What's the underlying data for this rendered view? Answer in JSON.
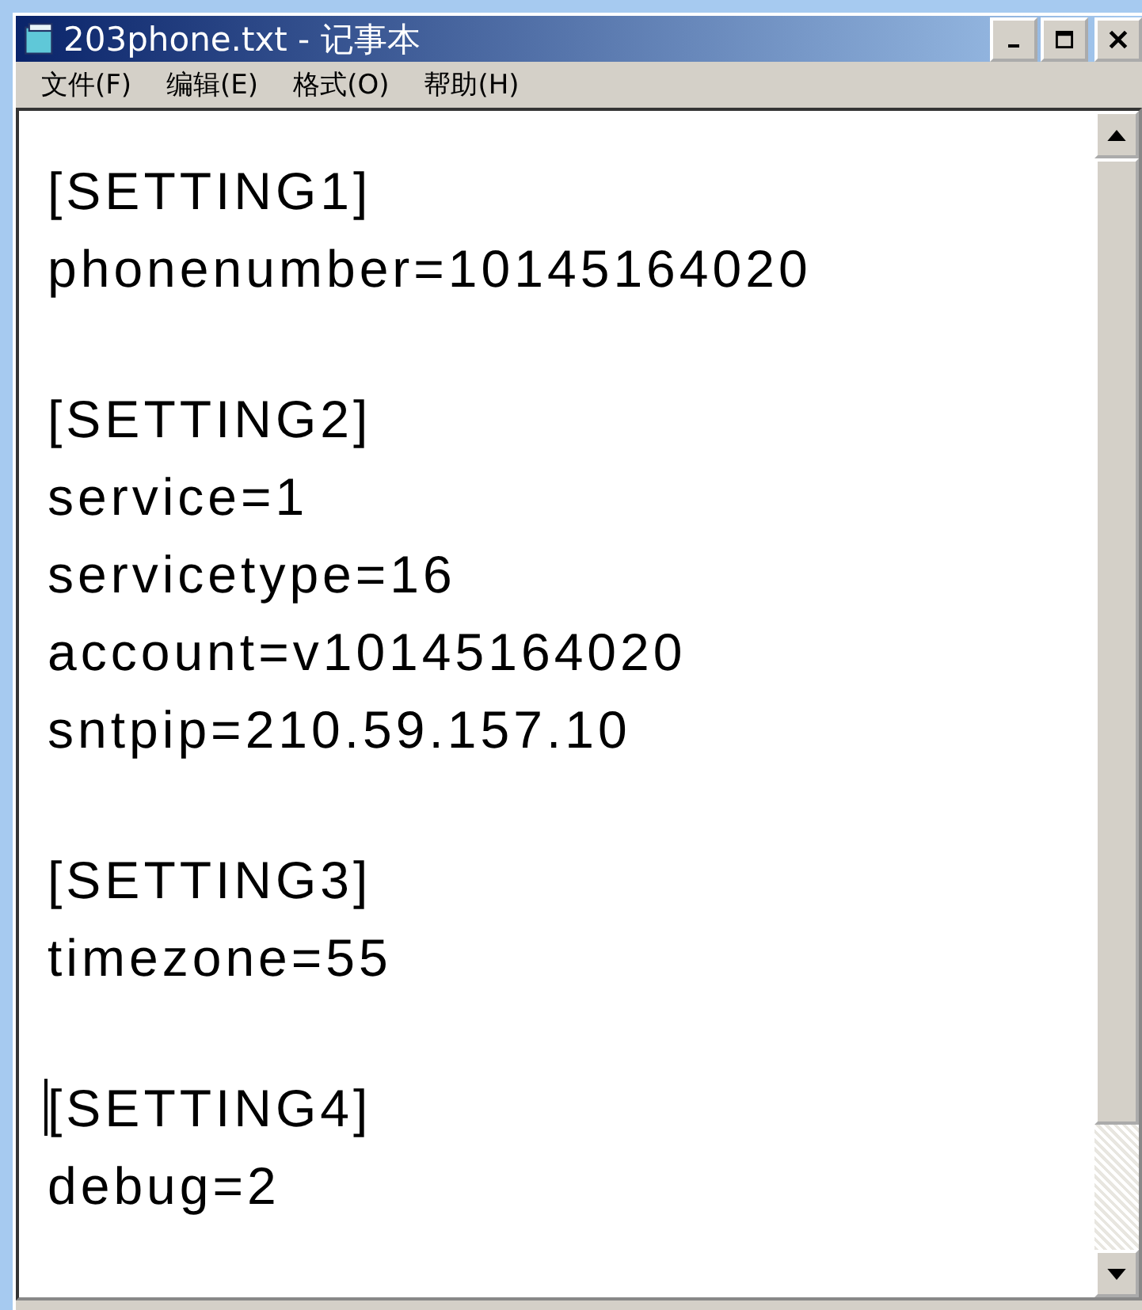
{
  "window": {
    "title": "203phone.txt - 记事本"
  },
  "menu": [
    {
      "label": "文件(F)"
    },
    {
      "label": "编辑(E)"
    },
    {
      "label": "格式(O)"
    },
    {
      "label": "帮助(H)"
    }
  ],
  "sections": [
    {
      "header": "[SETTING1]",
      "caret": false,
      "lines": [
        "phonenumber=10145164020"
      ]
    },
    {
      "header": "[SETTING2]",
      "caret": false,
      "lines": [
        "service=1",
        "servicetype=16",
        "account=v10145164020",
        "sntpip=210.59.157.10"
      ]
    },
    {
      "header": "[SETTING3]",
      "caret": false,
      "lines": [
        "timezone=55"
      ]
    },
    {
      "header": "[SETTING4]",
      "caret": true,
      "lines": [
        "debug=2"
      ]
    }
  ]
}
